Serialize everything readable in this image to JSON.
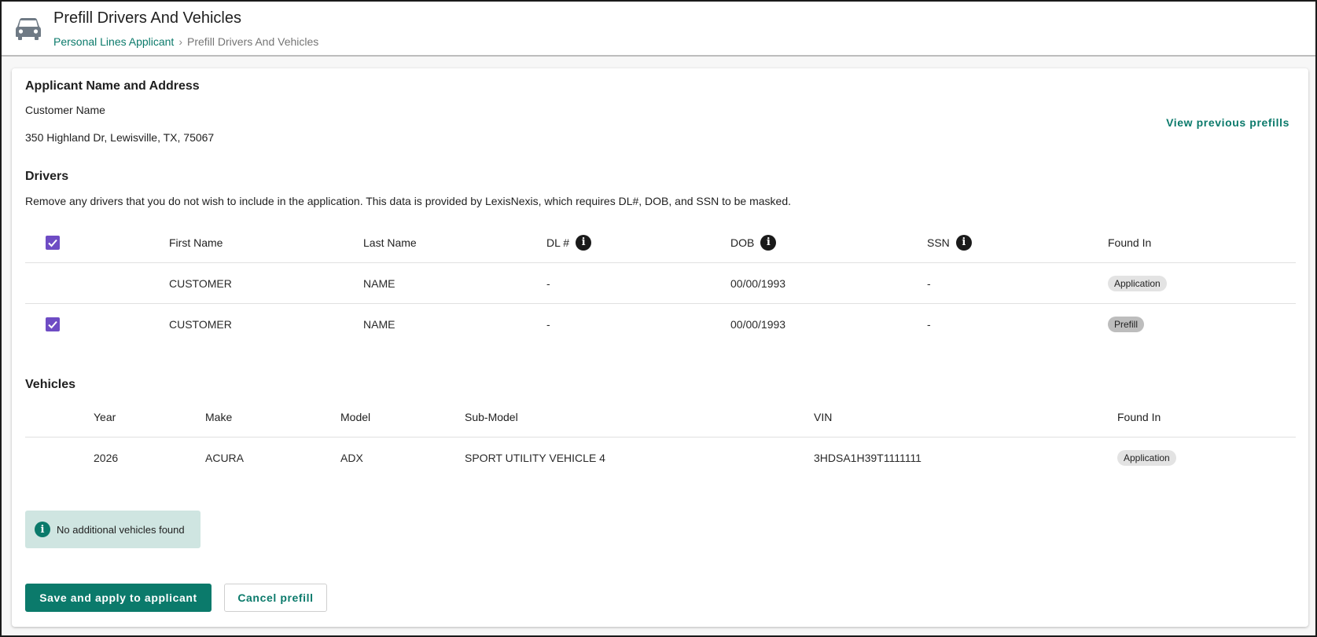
{
  "header": {
    "title": "Prefill Drivers And Vehicles",
    "icon": "car-icon",
    "breadcrumb": {
      "parent": "Personal Lines Applicant",
      "separator": "›",
      "current": "Prefill Drivers And Vehicles"
    }
  },
  "applicant": {
    "section_title": "Applicant Name and Address",
    "name": "Customer Name",
    "address": "350 Highland Dr, Lewisville, TX, 75067",
    "view_previous_label": "View previous prefills"
  },
  "drivers": {
    "section_title": "Drivers",
    "description": "Remove any drivers that you do not wish to include in the application. This data is provided by LexisNexis, which requires DL#, DOB, and SSN to be masked.",
    "columns": {
      "first_name": "First Name",
      "last_name": "Last Name",
      "dl": "DL #",
      "dob": "DOB",
      "ssn": "SSN",
      "found_in": "Found In"
    },
    "header_checked": true,
    "rows": [
      {
        "checkbox": false,
        "first_name": "CUSTOMER",
        "last_name": "NAME",
        "dl": "-",
        "dob": "00/00/1993",
        "ssn": "-",
        "found_in": "Application"
      },
      {
        "checkbox": true,
        "first_name": "CUSTOMER",
        "last_name": "NAME",
        "dl": "-",
        "dob": "00/00/1993",
        "ssn": "-",
        "found_in": "Prefill"
      }
    ]
  },
  "vehicles": {
    "section_title": "Vehicles",
    "columns": {
      "year": "Year",
      "make": "Make",
      "model": "Model",
      "sub_model": "Sub-Model",
      "vin": "VIN",
      "found_in": "Found In"
    },
    "rows": [
      {
        "year": "2026",
        "make": "ACURA",
        "model": "ADX",
        "sub_model": "SPORT UTILITY VEHICLE 4",
        "vin": "3HDSA1H39T1111111",
        "found_in": "Application"
      }
    ],
    "notice": "No additional vehicles found"
  },
  "actions": {
    "save_label": "Save and apply to applicant",
    "cancel_label": "Cancel prefill"
  },
  "colors": {
    "accent": "#0b7a6b",
    "checkbox": "#6e4cc4",
    "notice_bg": "#cfe5e1"
  }
}
